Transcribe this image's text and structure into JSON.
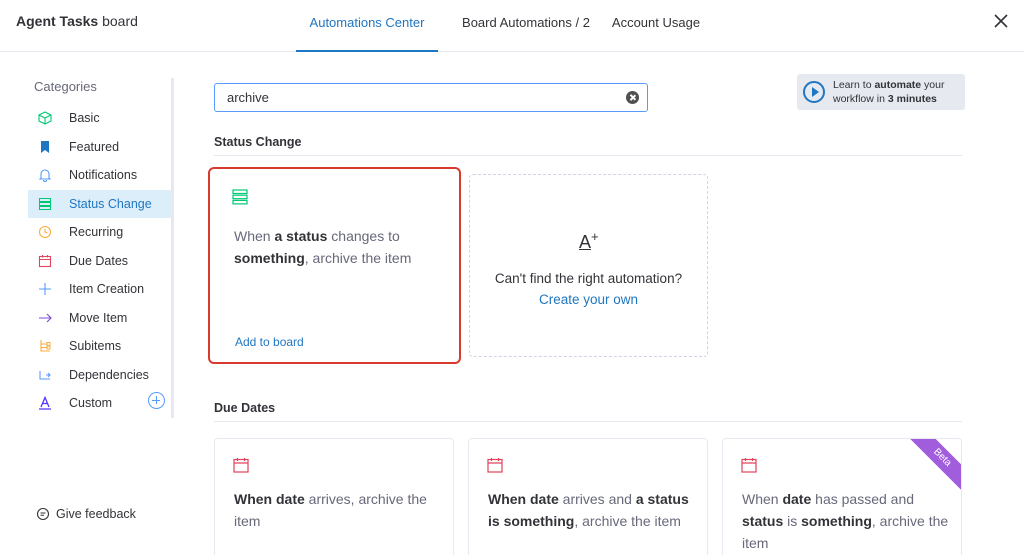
{
  "header": {
    "board_title_bold": "Agent Tasks",
    "board_title_rest": " board",
    "tabs": [
      {
        "label": "Automations Center",
        "active": true
      },
      {
        "label": "Board Automations / 2",
        "active": false
      },
      {
        "label": "Account Usage",
        "active": false
      }
    ]
  },
  "sidebar": {
    "title": "Categories",
    "items": [
      {
        "label": "Basic",
        "icon": "cube-icon"
      },
      {
        "label": "Featured",
        "icon": "bookmark-icon"
      },
      {
        "label": "Notifications",
        "icon": "bell-icon"
      },
      {
        "label": "Status Change",
        "icon": "status-list-icon",
        "active": true
      },
      {
        "label": "Recurring",
        "icon": "clock-icon"
      },
      {
        "label": "Due Dates",
        "icon": "calendar-icon"
      },
      {
        "label": "Item Creation",
        "icon": "plus-icon"
      },
      {
        "label": "Move Item",
        "icon": "arrow-right-icon"
      },
      {
        "label": "Subitems",
        "icon": "subitems-icon"
      },
      {
        "label": "Dependencies",
        "icon": "dependency-icon"
      },
      {
        "label": "Custom",
        "icon": "custom-a-icon"
      }
    ],
    "feedback": "Give feedback"
  },
  "search": {
    "value": "archive"
  },
  "learn": {
    "t1": "Learn to ",
    "b1": "automate",
    "t2": " your",
    "t3": "workflow in ",
    "b2": "3 minutes"
  },
  "sections": {
    "status_change": "Status Change",
    "due_dates": "Due Dates"
  },
  "status_card": {
    "p1": "When ",
    "b1": "a status",
    "p2": " changes to",
    "b2": "something",
    "p3": ", archive the item",
    "add_link": "Add to board"
  },
  "create_card": {
    "icon_letter": "A",
    "question": "Can't find the right automation?",
    "link": "Create your own"
  },
  "due_cards": [
    {
      "b1": "When date",
      "p1": " arrives, archive the item"
    },
    {
      "b1": "When date",
      "p1": " arrives and ",
      "b2": "a status",
      "b3": "is something",
      "p2": ", archive the item"
    },
    {
      "p0": "When ",
      "b1": "date",
      "p1": " has passed and ",
      "b2": "status",
      "p2": " is ",
      "b3": "something",
      "p3": ", archive the item",
      "badge": "Beta"
    }
  ],
  "colors": {
    "accent": "#1f76c2",
    "highlight_border": "#d83a2f",
    "beta": "#a25ddc"
  }
}
